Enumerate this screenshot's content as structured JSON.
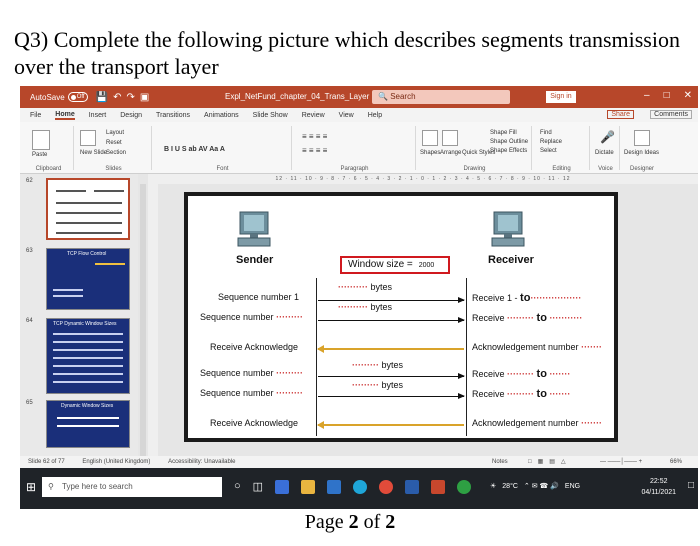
{
  "question": "Q3) Complete the following picture which describes segments transmission over the transport layer",
  "window": {
    "autosave_label": "AutoSave",
    "autosave_state": "Off",
    "doc_title": "Expl_NetFund_chapter_04_Trans_Layer",
    "search_placeholder": "Search",
    "signin_label": "Sign in"
  },
  "menu": [
    "File",
    "Home",
    "Insert",
    "Design",
    "Transitions",
    "Animations",
    "Slide Show",
    "Review",
    "View",
    "Help"
  ],
  "menu_active": "Home",
  "share_label": "Share",
  "comments_label": "Comments",
  "ribbon": {
    "groups": [
      "Clipboard",
      "Slides",
      "Font",
      "Paragraph",
      "Drawing",
      "Editing",
      "Voice",
      "Designer"
    ],
    "paste": "Paste",
    "new_slide": "New Slide",
    "layout": "Layout",
    "reset": "Reset",
    "section": "Section",
    "shapes": "Shapes",
    "arrange": "Arrange",
    "quick_styles": "Quick Styles",
    "shape_fill": "Shape Fill",
    "shape_outline": "Shape Outline",
    "shape_effects": "Shape Effects",
    "find": "Find",
    "replace": "Replace",
    "select": "Select",
    "dictate": "Dictate",
    "design_ideas": "Design Ideas"
  },
  "ruler_text": "12 · 11 · 10 · 9 · 8 · 7 · 6 · 5 · 4 · 3 · 2 · 1 · 0 · 1 · 2 · 3 · 4 · 5 · 6 · 7 · 8 · 9 · 10 · 11 · 12",
  "thumbnails": [
    {
      "num": "62",
      "title": ""
    },
    {
      "num": "63",
      "title": "TCP Flow Control"
    },
    {
      "num": "64",
      "title": "TCP Dynamic Window Sizes"
    },
    {
      "num": "65",
      "title": "Dynamic Window Sizes"
    }
  ],
  "slide": {
    "sender": "Sender",
    "receiver": "Receiver",
    "window_size_label": "Window size =",
    "window_size_value": "2000",
    "rows": [
      {
        "left": "Sequence number 1",
        "bytes": "bytes",
        "right_prefix": "Receive 1 -",
        "right_to": "to"
      },
      {
        "left": "Sequence number",
        "bytes": "bytes",
        "right_prefix": "Receive",
        "right_to": "to"
      },
      {
        "left": "Receive Acknowledge",
        "right_prefix": "Acknowledgement number"
      },
      {
        "left": "Sequence number",
        "bytes": "bytes",
        "right_prefix": "Receive",
        "right_to": "to"
      },
      {
        "left": "Sequence number",
        "bytes": "bytes",
        "right_prefix": "Receive",
        "right_to": "to"
      },
      {
        "left": "Receive Acknowledge",
        "right_prefix": "Acknowledgement number"
      }
    ]
  },
  "status": {
    "slide_info": "Slide 62 of 77",
    "language": "English (United Kingdom)",
    "accessibility": "Accessibility: Unavailable",
    "notes": "Notes",
    "zoom": "66%"
  },
  "taskbar": {
    "search_placeholder": "Type here to search",
    "weather": "28°C",
    "lang": "ENG",
    "time": "22:52",
    "date": "04/11/2021"
  },
  "footer": {
    "page_prefix": "Page",
    "page_num": "2",
    "of": "of",
    "page_total": "2"
  },
  "colors": {
    "ppt_accent": "#b7472a",
    "window_box_border": "#d0191f",
    "ack_arrow": "#d9a32a"
  }
}
